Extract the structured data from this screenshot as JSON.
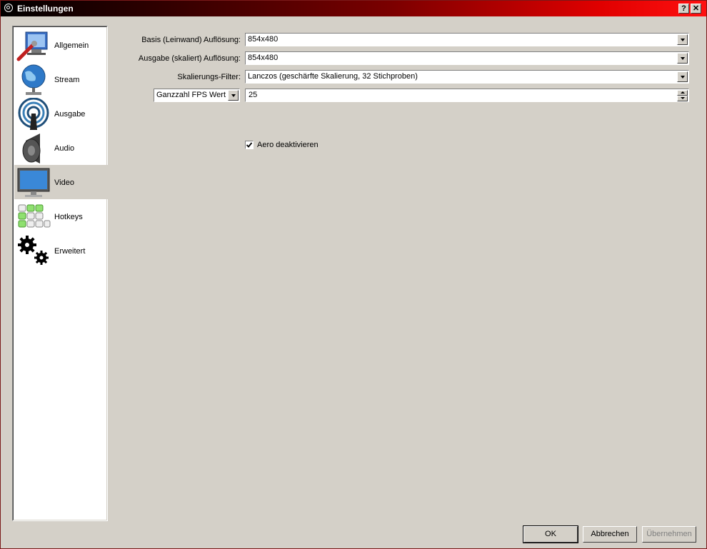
{
  "window": {
    "title": "Einstellungen",
    "help_button": "?",
    "close_button": "✕"
  },
  "sidebar": {
    "items": [
      {
        "label": "Allgemein",
        "icon": "general-settings-icon"
      },
      {
        "label": "Stream",
        "icon": "stream-globe-icon"
      },
      {
        "label": "Ausgabe",
        "icon": "output-broadcast-icon"
      },
      {
        "label": "Audio",
        "icon": "speaker-icon"
      },
      {
        "label": "Video",
        "icon": "monitor-icon",
        "active": true
      },
      {
        "label": "Hotkeys",
        "icon": "keyboard-icon"
      },
      {
        "label": "Erweitert",
        "icon": "gears-icon"
      }
    ]
  },
  "video": {
    "base_resolution_label": "Basis (Leinwand) Auflösung:",
    "base_resolution_value": "854x480",
    "output_resolution_label": "Ausgabe (skaliert) Auflösung:",
    "output_resolution_value": "854x480",
    "scale_filter_label": "Skalierungs-Filter:",
    "scale_filter_value": "Lanczos (geschärfte Skalierung, 32 Stichproben)",
    "fps_type_value": "Ganzzahl FPS Wert",
    "fps_value": "25",
    "aero_label": "Aero deaktivieren",
    "aero_checked": true
  },
  "buttons": {
    "ok": "OK",
    "cancel": "Abbrechen",
    "apply": "Übernehmen"
  }
}
